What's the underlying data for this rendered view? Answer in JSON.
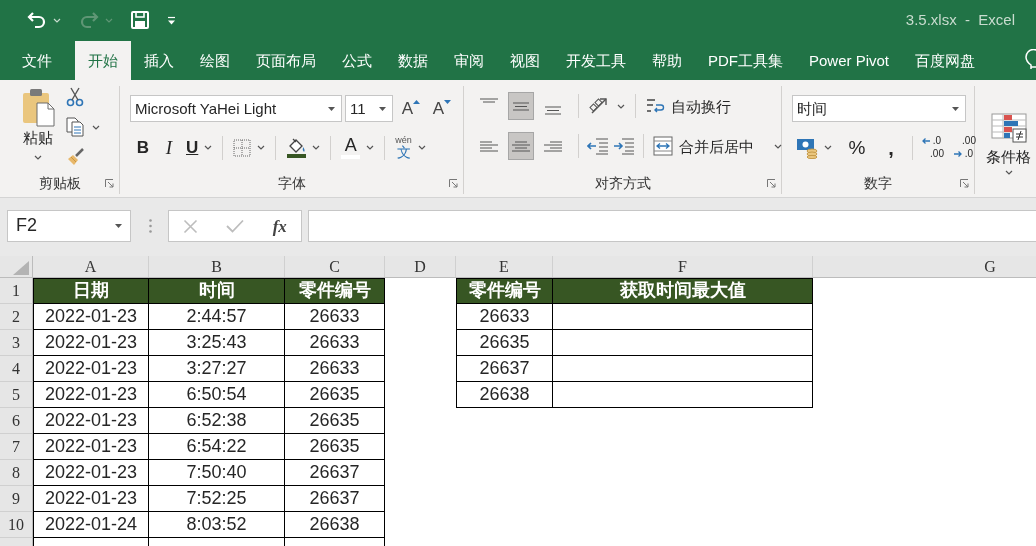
{
  "window": {
    "title": "3.5.xlsx  -  Excel"
  },
  "quick_access": [
    {
      "kind": "undo",
      "disabled": false
    },
    {
      "kind": "redo",
      "disabled": true
    },
    {
      "kind": "save",
      "disabled": false
    },
    {
      "kind": "customize",
      "disabled": false
    }
  ],
  "tabs": [
    {
      "label": "文件",
      "selected": false
    },
    {
      "label": "开始",
      "selected": true
    },
    {
      "label": "插入",
      "selected": false
    },
    {
      "label": "绘图",
      "selected": false
    },
    {
      "label": "页面布局",
      "selected": false
    },
    {
      "label": "公式",
      "selected": false
    },
    {
      "label": "数据",
      "selected": false
    },
    {
      "label": "审阅",
      "selected": false
    },
    {
      "label": "视图",
      "selected": false
    },
    {
      "label": "开发工具",
      "selected": false
    },
    {
      "label": "帮助",
      "selected": false
    },
    {
      "label": "PDF工具集",
      "selected": false
    },
    {
      "label": "Power Pivot",
      "selected": false
    },
    {
      "label": "百度网盘",
      "selected": false
    }
  ],
  "ribbon": {
    "groups": [
      {
        "kind": "clipboard",
        "label": "剪贴板",
        "paste": "粘贴"
      },
      {
        "kind": "font",
        "label": "字体",
        "font_name": "Microsoft YaHei Light",
        "font_size": "11",
        "grow": "A",
        "shrink": "A",
        "bold": "B",
        "italic": "I",
        "underline": "U",
        "color_buttons": [
          {
            "kind": "fill",
            "color": "#375623"
          },
          {
            "kind": "font",
            "glyph": "A",
            "color": "#ffffff"
          }
        ],
        "phonetic_top": "wén",
        "phonetic_bottom": "文"
      },
      {
        "kind": "alignment",
        "label": "对齐方式",
        "vertical": [
          {
            "kind": "top",
            "selected": false
          },
          {
            "kind": "middle",
            "selected": true
          },
          {
            "kind": "bottom",
            "selected": false
          }
        ],
        "horizontal": [
          {
            "kind": "left",
            "selected": false
          },
          {
            "kind": "center",
            "selected": true
          },
          {
            "kind": "right",
            "selected": false
          }
        ],
        "wrap_text": "自动换行",
        "merge": "合并后居中"
      },
      {
        "kind": "number",
        "label": "数字",
        "format": "时间",
        "percent": "%",
        "comma": ",",
        "increase_decimal": [
          ".0",
          ".00"
        ],
        "decrease_decimal": [
          ".00",
          ".0"
        ]
      },
      {
        "kind": "styles",
        "conditional_formatting": "条件格"
      }
    ]
  },
  "formula_bar": {
    "name_box": "F2",
    "editing": false,
    "insert_function": "fx"
  },
  "sheet": {
    "columns": [
      "A",
      "B",
      "C",
      "D",
      "E",
      "F",
      "G"
    ],
    "rows": [
      {
        "number": "1",
        "cells": [
          {
            "kind": "header",
            "text": "日期"
          },
          {
            "kind": "header",
            "text": "时间"
          },
          {
            "kind": "header",
            "text": "零件编号"
          },
          {
            "kind": "blank"
          },
          {
            "kind": "header",
            "text": "零件编号"
          },
          {
            "kind": "header",
            "text": "获取时间最大值"
          },
          {
            "kind": "blank"
          }
        ]
      },
      {
        "number": "2",
        "cells": [
          {
            "kind": "data",
            "text": "2022-01-23"
          },
          {
            "kind": "data",
            "text": "2:44:57"
          },
          {
            "kind": "data",
            "text": "26633"
          },
          {
            "kind": "blank"
          },
          {
            "kind": "data",
            "text": "26633"
          },
          {
            "kind": "data"
          },
          {
            "kind": "blank"
          }
        ]
      },
      {
        "number": "3",
        "cells": [
          {
            "kind": "data",
            "text": "2022-01-23"
          },
          {
            "kind": "data",
            "text": "3:25:43"
          },
          {
            "kind": "data",
            "text": "26633"
          },
          {
            "kind": "blank"
          },
          {
            "kind": "data",
            "text": "26635"
          },
          {
            "kind": "data"
          },
          {
            "kind": "blank"
          }
        ]
      },
      {
        "number": "4",
        "cells": [
          {
            "kind": "data",
            "text": "2022-01-23"
          },
          {
            "kind": "data",
            "text": "3:27:27"
          },
          {
            "kind": "data",
            "text": "26633"
          },
          {
            "kind": "blank"
          },
          {
            "kind": "data",
            "text": "26637"
          },
          {
            "kind": "data"
          },
          {
            "kind": "blank"
          }
        ]
      },
      {
        "number": "5",
        "cells": [
          {
            "kind": "data",
            "text": "2022-01-23"
          },
          {
            "kind": "data",
            "text": "6:50:54"
          },
          {
            "kind": "data",
            "text": "26635"
          },
          {
            "kind": "blank"
          },
          {
            "kind": "data",
            "text": "26638"
          },
          {
            "kind": "data"
          },
          {
            "kind": "blank"
          }
        ]
      },
      {
        "number": "6",
        "cells": [
          {
            "kind": "data",
            "text": "2022-01-23"
          },
          {
            "kind": "data",
            "text": "6:52:38"
          },
          {
            "kind": "data",
            "text": "26635"
          },
          {
            "kind": "blank"
          },
          {
            "kind": "blank"
          },
          {
            "kind": "blank"
          },
          {
            "kind": "blank"
          }
        ]
      },
      {
        "number": "7",
        "cells": [
          {
            "kind": "data",
            "text": "2022-01-23"
          },
          {
            "kind": "data",
            "text": "6:54:22"
          },
          {
            "kind": "data",
            "text": "26635"
          },
          {
            "kind": "blank"
          },
          {
            "kind": "blank"
          },
          {
            "kind": "blank"
          },
          {
            "kind": "blank"
          }
        ]
      },
      {
        "number": "8",
        "cells": [
          {
            "kind": "data",
            "text": "2022-01-23"
          },
          {
            "kind": "data",
            "text": "7:50:40"
          },
          {
            "kind": "data",
            "text": "26637"
          },
          {
            "kind": "blank"
          },
          {
            "kind": "blank"
          },
          {
            "kind": "blank"
          },
          {
            "kind": "blank"
          }
        ]
      },
      {
        "number": "9",
        "cells": [
          {
            "kind": "data",
            "text": "2022-01-23"
          },
          {
            "kind": "data",
            "text": "7:52:25"
          },
          {
            "kind": "data",
            "text": "26637"
          },
          {
            "kind": "blank"
          },
          {
            "kind": "blank"
          },
          {
            "kind": "blank"
          },
          {
            "kind": "blank"
          }
        ]
      },
      {
        "number": "10",
        "cells": [
          {
            "kind": "data",
            "text": "2022-01-24"
          },
          {
            "kind": "data",
            "text": "8:03:52"
          },
          {
            "kind": "data",
            "text": "26638"
          },
          {
            "kind": "blank"
          },
          {
            "kind": "blank"
          },
          {
            "kind": "blank"
          },
          {
            "kind": "blank"
          }
        ]
      },
      {
        "cells": [
          {
            "kind": "data"
          },
          {
            "kind": "data"
          },
          {
            "kind": "data"
          },
          {
            "kind": "blank"
          },
          {
            "kind": "blank"
          },
          {
            "kind": "blank"
          },
          {
            "kind": "blank"
          }
        ]
      }
    ]
  }
}
